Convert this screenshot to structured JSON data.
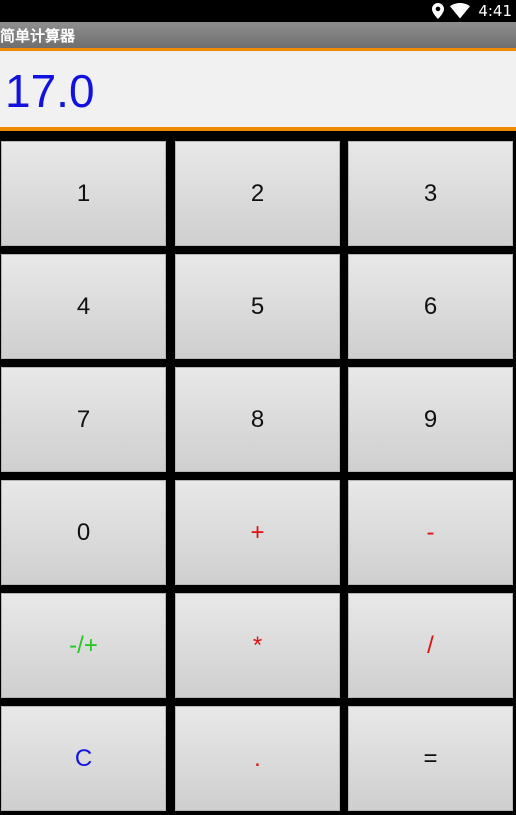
{
  "status_bar": {
    "time": "4:41",
    "icons": [
      "location-icon",
      "wifi-icon"
    ]
  },
  "app": {
    "title": "简单计算器"
  },
  "display": {
    "value": "17.0",
    "color": "#1212e0"
  },
  "keys": [
    {
      "label": "1",
      "type": "digit"
    },
    {
      "label": "2",
      "type": "digit"
    },
    {
      "label": "3",
      "type": "digit"
    },
    {
      "label": "4",
      "type": "digit"
    },
    {
      "label": "5",
      "type": "digit"
    },
    {
      "label": "6",
      "type": "digit"
    },
    {
      "label": "7",
      "type": "digit"
    },
    {
      "label": "8",
      "type": "digit"
    },
    {
      "label": "9",
      "type": "digit"
    },
    {
      "label": "0",
      "type": "digit"
    },
    {
      "label": "+",
      "type": "operator"
    },
    {
      "label": "-",
      "type": "operator"
    },
    {
      "label": "-/+",
      "type": "sign"
    },
    {
      "label": "*",
      "type": "operator"
    },
    {
      "label": "/",
      "type": "operator"
    },
    {
      "label": "C",
      "type": "clear"
    },
    {
      "label": ".",
      "type": "operator"
    },
    {
      "label": "=",
      "type": "equals"
    }
  ],
  "colors": {
    "accent_orange": "#f08a00",
    "operator_red": "#e01010",
    "sign_green": "#1ec81e",
    "clear_blue": "#1414e0"
  }
}
